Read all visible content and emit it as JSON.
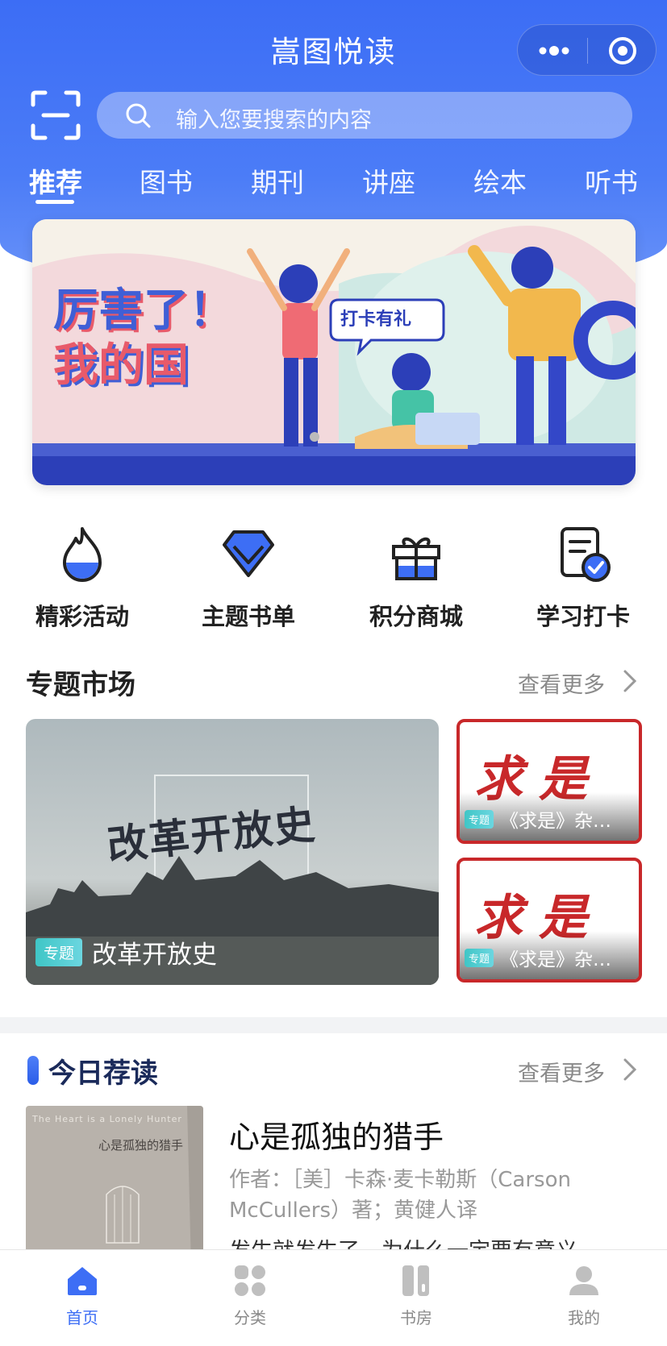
{
  "header": {
    "title": "嵩图悦读",
    "search_placeholder": "输入您要搜索的内容"
  },
  "tabs": [
    {
      "label": "推荐",
      "active": true
    },
    {
      "label": "图书"
    },
    {
      "label": "期刊"
    },
    {
      "label": "讲座"
    },
    {
      "label": "绘本"
    },
    {
      "label": "听书"
    }
  ],
  "banner": {
    "headline_line1": "厉害了！",
    "headline_line2": "我的国",
    "tag": "打卡有礼"
  },
  "quick_links": [
    {
      "label": "精彩活动",
      "icon": "flame-icon"
    },
    {
      "label": "主题书单",
      "icon": "diamond-icon"
    },
    {
      "label": "积分商城",
      "icon": "gift-icon"
    },
    {
      "label": "学习打卡",
      "icon": "checkin-icon"
    }
  ],
  "topic_market": {
    "title": "专题市场",
    "more": "查看更多",
    "featured": {
      "badge": "专题",
      "title": "改革开放史",
      "art_text": "改革开放史"
    },
    "items": [
      {
        "badge": "专题",
        "title": "《求是》杂…",
        "cover_text": "求是"
      },
      {
        "badge": "专题",
        "title": "《求是》杂…",
        "cover_text": "求是"
      }
    ]
  },
  "today": {
    "title": "今日荐读",
    "more": "查看更多",
    "book": {
      "title": "心是孤独的猎手",
      "author": "作者：［美］卡森·麦卡勒斯（Carson McCullers）著；黄健人译",
      "quote": "发生就发生了，为什么一定要有意义",
      "cover_en": "The Heart is a Lonely Hunter",
      "cover_cn": "心是孤独的猎手"
    }
  },
  "bottom_nav": [
    {
      "label": "首页",
      "active": true
    },
    {
      "label": "分类"
    },
    {
      "label": "书房"
    },
    {
      "label": "我的"
    }
  ],
  "colors": {
    "primary": "#3d6ef5",
    "header_gradient_top": "#3c6df5",
    "badge": "#3fc6c6",
    "qiushi_red": "#c8282a"
  }
}
